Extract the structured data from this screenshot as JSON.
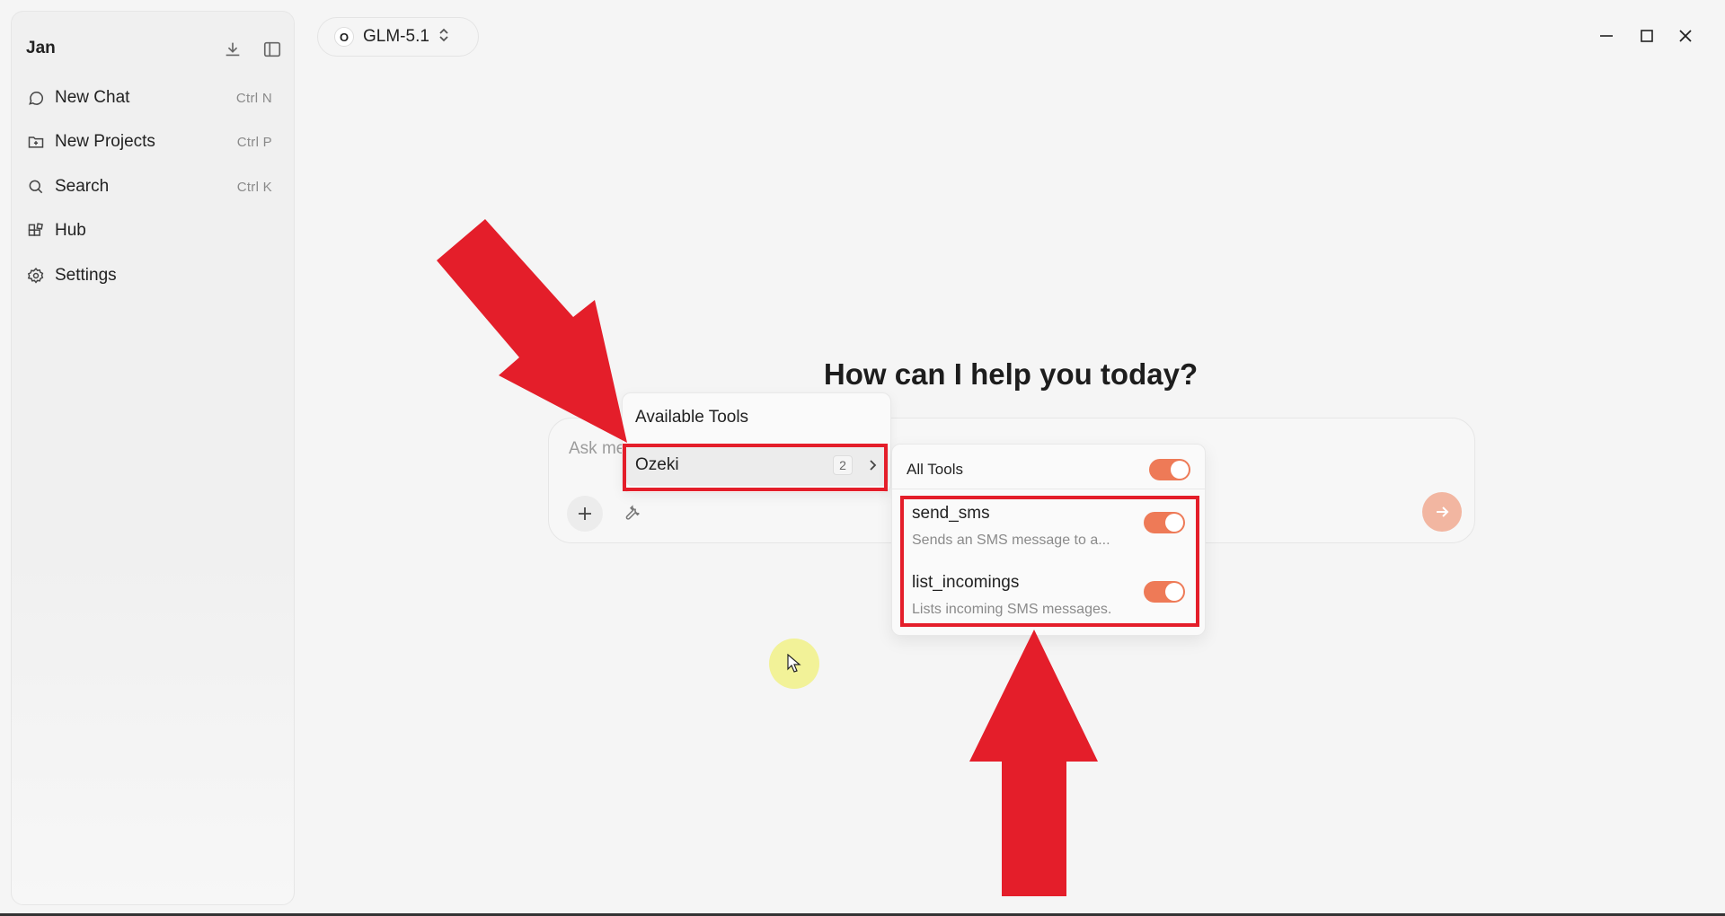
{
  "sidebar": {
    "app_name": "Jan",
    "items": [
      {
        "label": "New Chat",
        "shortcut": "Ctrl  N",
        "icon": "chat-bubble-icon"
      },
      {
        "label": "New Projects",
        "shortcut": "Ctrl  P",
        "icon": "folder-plus-icon"
      },
      {
        "label": "Search",
        "shortcut": "Ctrl  K",
        "icon": "search-icon"
      },
      {
        "label": "Hub",
        "shortcut": "",
        "icon": "grid-icon"
      },
      {
        "label": "Settings",
        "shortcut": "",
        "icon": "gear-icon"
      }
    ]
  },
  "model": {
    "initial": "O",
    "name": "GLM-5.1"
  },
  "main": {
    "headline": "How can I help you today?",
    "input_placeholder": "Ask me anything..."
  },
  "tools_menu": {
    "title": "Available Tools",
    "server": {
      "name": "Ozeki",
      "count": "2"
    }
  },
  "tools_submenu": {
    "all_label": "All Tools",
    "all_enabled": true,
    "tools": [
      {
        "name": "send_sms",
        "description": "Sends an SMS message to a...",
        "enabled": true
      },
      {
        "name": "list_incomings",
        "description": "Lists incoming SMS messages.",
        "enabled": true
      }
    ]
  },
  "colors": {
    "accent": "#ee7a57",
    "annotation_red": "#e41e2a",
    "send_button": "#f2b6a1"
  }
}
